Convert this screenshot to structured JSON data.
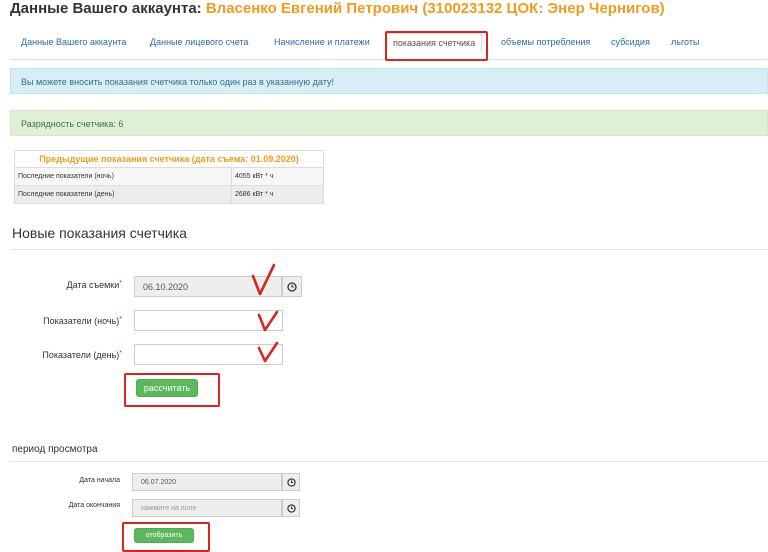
{
  "header": {
    "title_prefix": "Данные Вашего аккаунта:",
    "account_name": "Власенко Евгений Петрович (310023132 ЦОК: Энер Чернигов)"
  },
  "tabs": [
    {
      "label": "Данные Вашего аккаунта"
    },
    {
      "label": "Данные лицевого счета"
    },
    {
      "label": "Начисление и платежи"
    },
    {
      "label": "показания счетчика",
      "active": true
    },
    {
      "label": "объемы потребления"
    },
    {
      "label": "субсидия"
    },
    {
      "label": "льготы"
    }
  ],
  "alerts": {
    "info": "Вы можете вносить показания счетчика только один раз в указанную дату!",
    "success": "Разрядность счетчика: 6"
  },
  "previous_readings": {
    "title": "Предыдущие показания счетчика (дата съема: 01.09.2020)",
    "rows": [
      {
        "label": "Последние показатели (ночь)",
        "value": "4055 кВт * ч"
      },
      {
        "label": "Последние показатели (день)",
        "value": "2686 кВт * ч"
      }
    ]
  },
  "new_readings": {
    "heading": "Новые показания счетчика",
    "date_label": "Дата съемки",
    "date_value": "06.10.2020",
    "night_label": "Показатели (ночь)",
    "night_value": "",
    "day_label": "Показатели (день)",
    "day_value": "",
    "required_mark": "*",
    "calculate_button": "рассчитать"
  },
  "view_period": {
    "heading": "период просмотра",
    "start_label": "Дата начала",
    "start_value": "06.07.2020",
    "end_label": "Дата окончания",
    "end_placeholder": "нажмите на поле",
    "show_button": "отобразить"
  },
  "colors": {
    "accent_orange": "#f29b1d",
    "link_blue": "#2a6db0",
    "button_green": "#5cb85c",
    "highlight_red": "#d9251c"
  },
  "icons": {
    "clock": "clock-icon",
    "check": "checkmark-annotation-icon"
  }
}
